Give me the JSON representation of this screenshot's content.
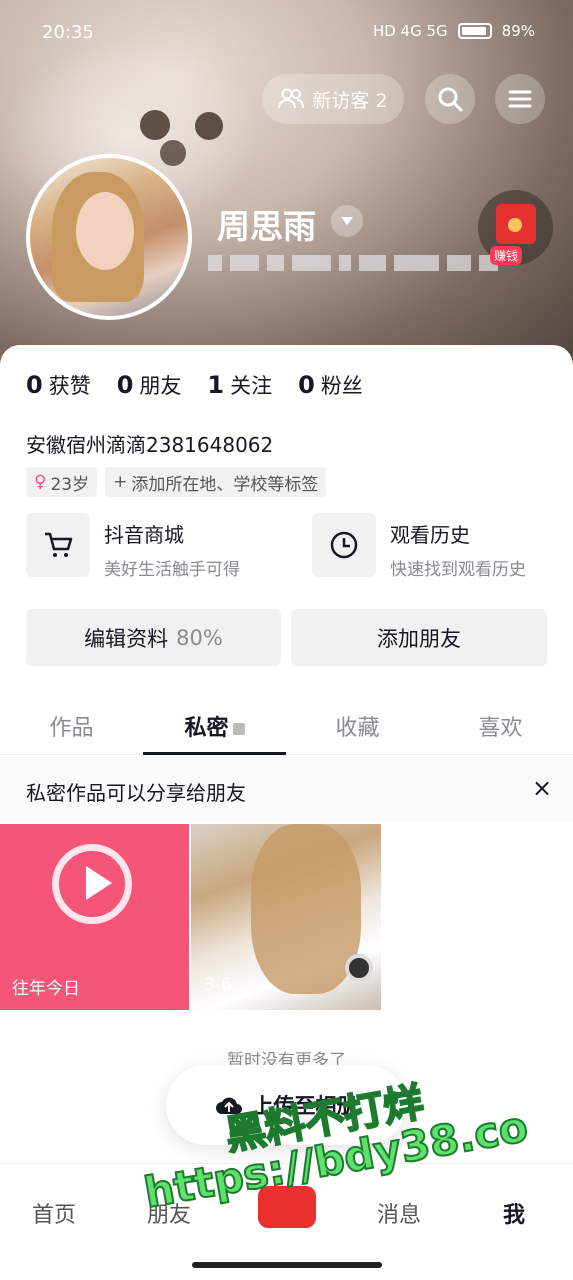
{
  "status_bar": {
    "time": "20:35",
    "battery": "89%",
    "indicators": "HD 4G 5G"
  },
  "header": {
    "visitor_label": "新访客 2",
    "name": "周思雨",
    "earn_label": "赚钱"
  },
  "stats": [
    {
      "num": "0",
      "label": "获赞"
    },
    {
      "num": "0",
      "label": "朋友"
    },
    {
      "num": "1",
      "label": "关注"
    },
    {
      "num": "0",
      "label": "粉丝"
    }
  ],
  "bio": "安徽宿州滴滴2381648062",
  "tags": {
    "age": "23岁",
    "add_tag": "添加所在地、学校等标签"
  },
  "shortcuts": {
    "shop": {
      "title": "抖音商城",
      "subtitle": "美好生活触手可得"
    },
    "history": {
      "title": "观看历史",
      "subtitle": "快速找到观看历史"
    }
  },
  "actions": {
    "edit_label": "编辑资料",
    "edit_percent": "80%",
    "add_friend": "添加朋友"
  },
  "tabs": [
    "作品",
    "私密",
    "收藏",
    "喜欢"
  ],
  "notice": {
    "text": "私密作品可以分享给朋友",
    "close": "×"
  },
  "grid": [
    {
      "label": "往年今日"
    },
    {
      "label": "3-6"
    }
  ],
  "no_more": "暂时没有更多了",
  "upload_label": "上传至相册",
  "bottom_nav": {
    "home": "首页",
    "friends": "朋友",
    "messages": "消息",
    "me": "我"
  },
  "watermark": {
    "line1": "黑料不打烊",
    "line2": "https://bdy38.co"
  }
}
